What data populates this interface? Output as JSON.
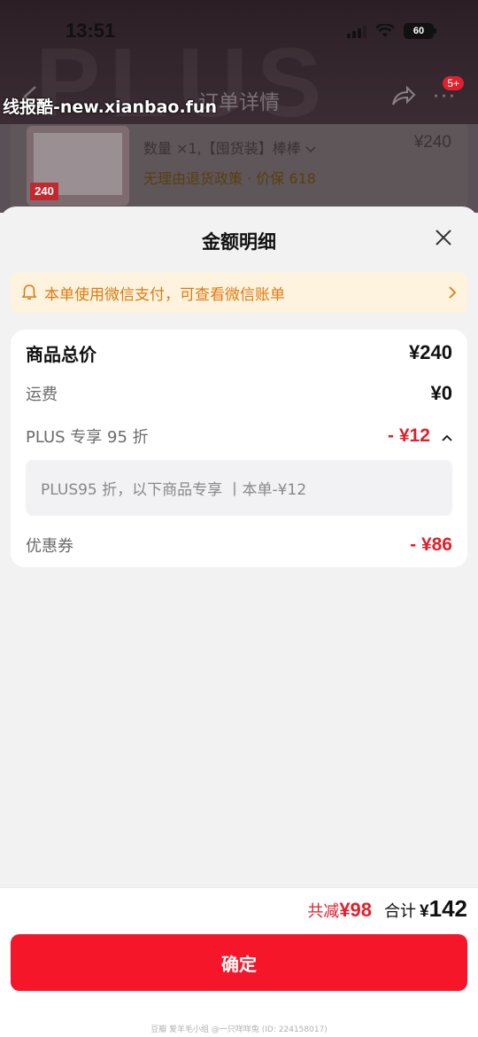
{
  "status_bar": {
    "time": "13:51",
    "battery": "60"
  },
  "nav": {
    "title": "订单详情",
    "badge": "5+",
    "site_watermark": "线报酷-new.xianbao.fun"
  },
  "background_product": {
    "thumb_price": "240",
    "quantity_text": "数量 ×1,【囤货装】棒棒",
    "price": "¥240",
    "policy_text": "无理由退货政策 · 价保 618"
  },
  "sheet": {
    "title": "金额明细",
    "notice": "本单使用微信支付，可查看微信账单",
    "rows": {
      "goods_total": {
        "label": "商品总价",
        "value": "¥240"
      },
      "shipping": {
        "label": "运费",
        "value": "¥0"
      },
      "plus": {
        "label": "PLUS 专享 95 折",
        "value": "- ¥12",
        "detail": "PLUS95 折，以下商品专享 丨本单-¥12"
      },
      "coupon": {
        "label": "优惠券",
        "value": "- ¥86"
      }
    }
  },
  "footer": {
    "saved_label": "共减",
    "saved_value": "¥98",
    "total_label": "合计",
    "total_currency": "¥",
    "total_value": "142",
    "confirm_label": "确定",
    "watermark": "豆瓣 爱羊毛小组 @一只咩咩兔 (ID: 224158017)"
  },
  "colors": {
    "accent_red": "#e0202c",
    "button_red": "#f5162a",
    "notice_orange": "#e07a10",
    "notice_bg": "#fdf3df"
  },
  "icons": [
    "back-arrow-icon",
    "share-icon",
    "more-icon",
    "close-icon",
    "bell-icon",
    "chevron-right-icon",
    "chevron-up-icon",
    "chevron-down-icon",
    "signal-icon",
    "wifi-icon",
    "battery-icon"
  ]
}
